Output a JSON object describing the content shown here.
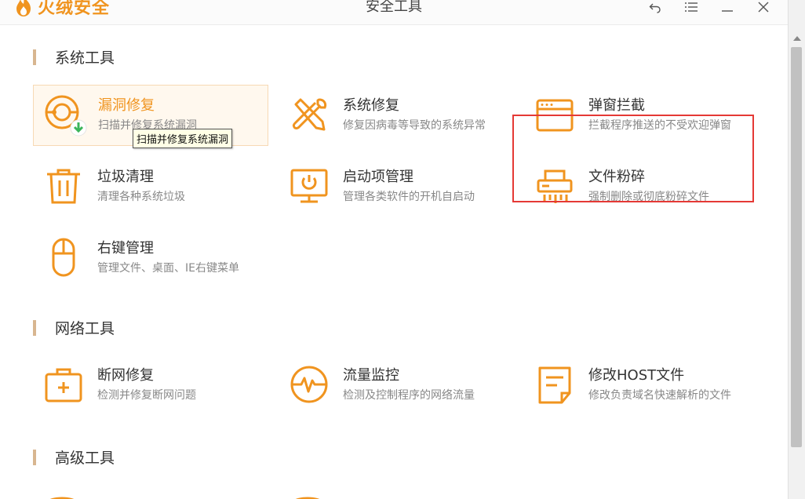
{
  "app": {
    "logo_text": "火绒安全",
    "title": "安全工具",
    "accent": "#f0941f"
  },
  "window_buttons": [
    {
      "icon": "back-icon"
    },
    {
      "icon": "menu-icon"
    },
    {
      "icon": "minimize-icon"
    },
    {
      "icon": "close-icon"
    }
  ],
  "sections": [
    {
      "title": "系统工具"
    },
    {
      "title": "网络工具"
    },
    {
      "title": "高级工具"
    }
  ],
  "tools": {
    "vuln_fix": {
      "name": "漏洞修复",
      "desc": "扫描并修复系统漏洞",
      "icon": "vulnerability-fix-icon"
    },
    "sys_fix": {
      "name": "系统修复",
      "desc": "修复因病毒等导致的系统异常",
      "icon": "wrench-screwdriver-icon"
    },
    "popup_block": {
      "name": "弹窗拦截",
      "desc": "拦截程序推送的不受欢迎弹窗",
      "icon": "popup-window-icon"
    },
    "junk_clean": {
      "name": "垃圾清理",
      "desc": "清理各种系统垃圾",
      "icon": "trash-icon"
    },
    "startup_mgr": {
      "name": "启动项管理",
      "desc": "管理各类软件的开机自启动",
      "icon": "monitor-power-icon"
    },
    "file_shred": {
      "name": "文件粉碎",
      "desc": "强制删除或彻底粉碎文件",
      "icon": "shredder-icon"
    },
    "right_click": {
      "name": "右键管理",
      "desc": "管理文件、桌面、IE右键菜单",
      "icon": "mouse-icon"
    },
    "net_fix": {
      "name": "断网修复",
      "desc": "检测并修复断网问题",
      "icon": "first-aid-kit-icon"
    },
    "traffic_mon": {
      "name": "流量监控",
      "desc": "检测及控制程序的网络流量",
      "icon": "pulse-monitor-icon"
    },
    "host_edit": {
      "name": "修改HOST文件",
      "desc": "修改负责域名快速解析的文件",
      "icon": "document-edit-icon"
    }
  },
  "tooltip": {
    "text": "扫描并修复系统漏洞"
  }
}
